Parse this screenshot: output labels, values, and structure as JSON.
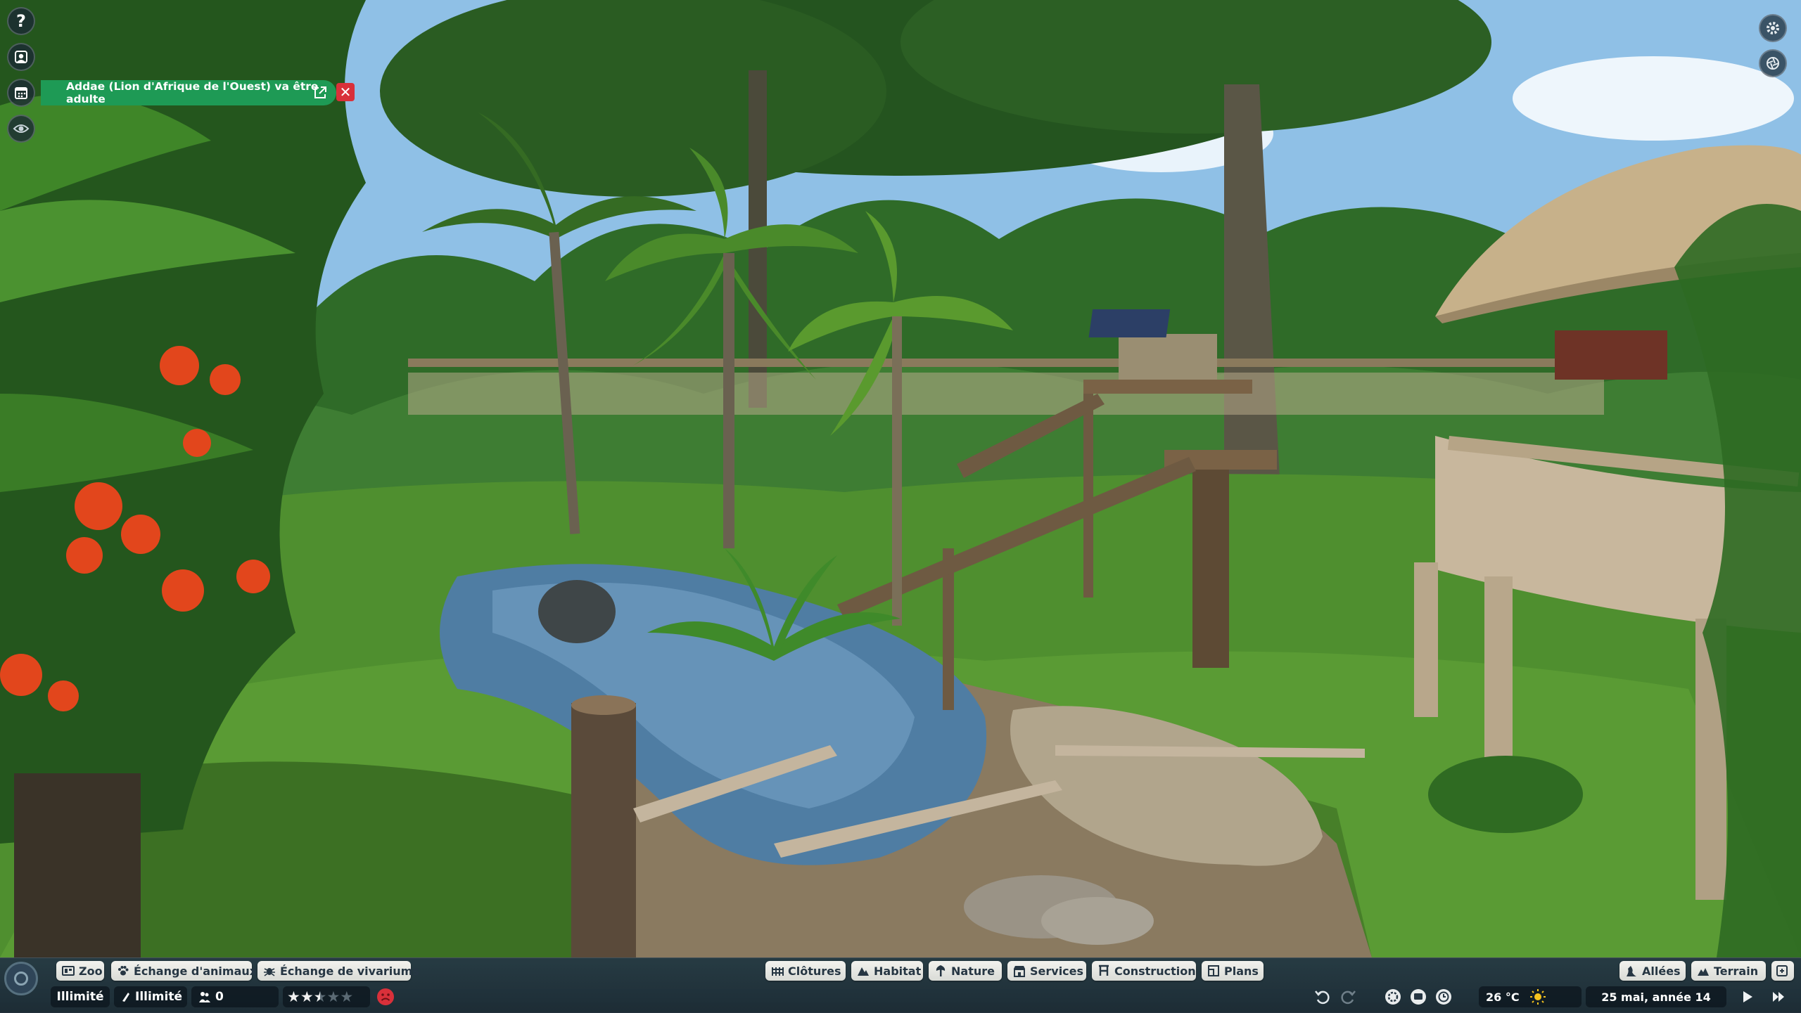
{
  "notification": {
    "text": "Addae (Lion d'Afrique de l'Ouest) va être adulte",
    "open_icon": "external-link-icon",
    "close_icon": "close-icon",
    "color": "#1e9a55"
  },
  "left_toolbar": {
    "items": [
      {
        "icon": "help-icon",
        "glyph": "?"
      },
      {
        "icon": "zookeeper-icon"
      },
      {
        "icon": "calendar-icon"
      },
      {
        "icon": "eye-icon"
      }
    ]
  },
  "top_right": {
    "items": [
      {
        "icon": "settings-gear-icon"
      },
      {
        "icon": "photo-mode-icon"
      }
    ]
  },
  "bottom_bar": {
    "left_tabs": [
      {
        "label": "Zoo",
        "icon": "zoo-icon"
      },
      {
        "label": "Échange d'animaux",
        "icon": "paw-icon"
      },
      {
        "label": "Échange de vivariums",
        "icon": "bug-icon"
      }
    ],
    "build_tabs": [
      {
        "label": "Clôtures",
        "icon": "fence-icon"
      },
      {
        "label": "Habitat",
        "icon": "habitat-icon"
      },
      {
        "label": "Nature",
        "icon": "tree-icon"
      },
      {
        "label": "Services",
        "icon": "shop-icon"
      },
      {
        "label": "Construction",
        "icon": "construction-icon"
      },
      {
        "label": "Plans",
        "icon": "blueprint-icon"
      }
    ],
    "right_tabs": [
      {
        "label": "Allées",
        "icon": "path-icon"
      },
      {
        "label": "Terrain",
        "icon": "terrain-icon"
      }
    ],
    "stats": {
      "money": "Illimité",
      "research": "Illimité",
      "guests": "0",
      "rating_stars": 2.5,
      "rating_max": 5
    },
    "time": {
      "temperature": "26 °C",
      "weather_icon": "sun-icon",
      "date": "25 mai, année 14"
    }
  },
  "colors": {
    "bar_bg": "#263846",
    "pill_bg": "#e8e9e5",
    "pill_text": "#263643",
    "alert_red": "#d9303a"
  }
}
